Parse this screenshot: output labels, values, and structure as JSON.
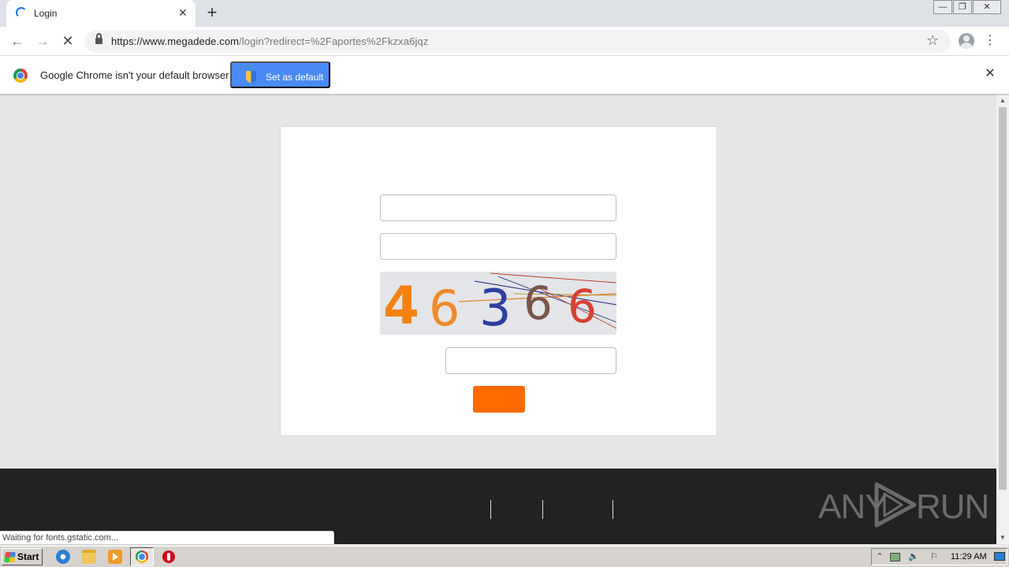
{
  "browser": {
    "tab": {
      "title": "Login",
      "close_glyph": "✕"
    },
    "new_tab_glyph": "+",
    "window_controls": {
      "minimize": "—",
      "restore": "❐",
      "close": "✕"
    },
    "toolbar": {
      "back_glyph": "←",
      "forward_glyph": "→",
      "stop_glyph": "✕",
      "url_host": "https://www.megadede.com",
      "url_path": "/login?redirect=%2Faportes%2Fkzxa6jqz",
      "bookmark_glyph": "☆",
      "menu_glyph": "⋮"
    },
    "infobar": {
      "message": "Google Chrome isn't your default browser",
      "button_label": "Set as default",
      "close_glyph": "✕"
    },
    "status_text": "Waiting for fonts.gstatic.com..."
  },
  "login_form": {
    "username": {
      "value": "",
      "placeholder": ""
    },
    "password": {
      "value": "",
      "placeholder": ""
    },
    "captcha": {
      "digits": [
        "4",
        "6",
        "3",
        "6",
        "6"
      ],
      "digit_colors": [
        "#f5820d",
        "#f0892a",
        "#2f3e9e",
        "#7a5448",
        "#d84030"
      ]
    },
    "captcha_input": {
      "value": "",
      "placeholder": ""
    },
    "submit_label": "",
    "submit_color": "#ff6a00"
  },
  "footer": {
    "background": "#222222"
  },
  "watermark": {
    "left": "ANY",
    "right": "RUN"
  },
  "taskbar": {
    "start_label": "Start",
    "clock": "11:29 AM",
    "tray_glyphs": {
      "expand": "⌃",
      "volume": "🔈",
      "flag": "⚐"
    }
  },
  "scrollbar": {
    "up_glyph": "▲",
    "down_glyph": "▼"
  }
}
